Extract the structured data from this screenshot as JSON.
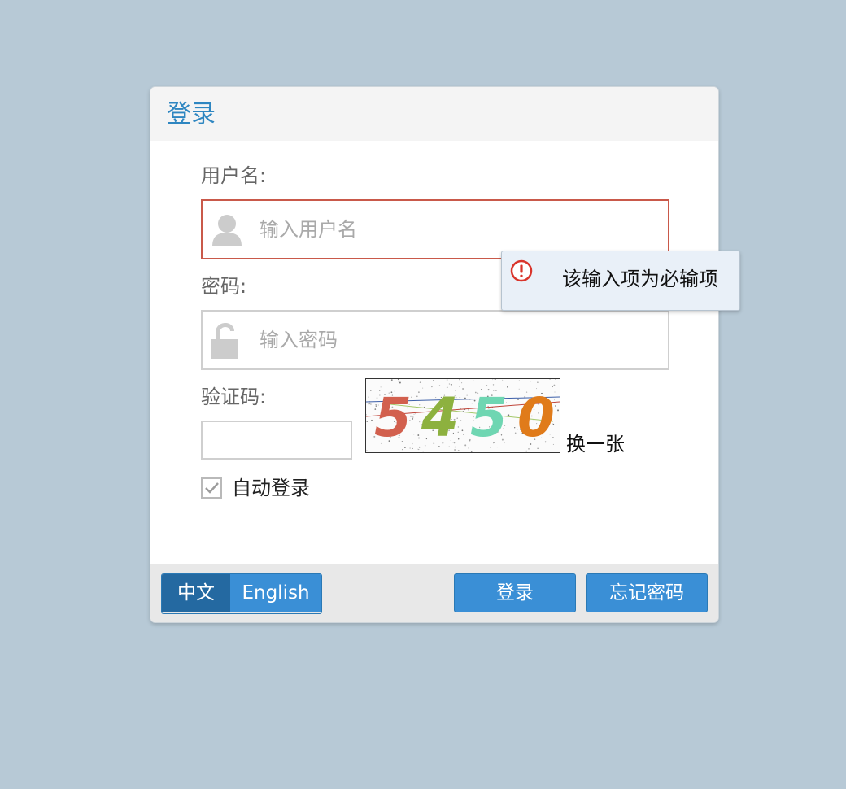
{
  "dialog": {
    "title": "登录"
  },
  "form": {
    "username_label": "用户名:",
    "username_placeholder": "输入用户名",
    "password_label": "密码:",
    "password_placeholder": "输入密码",
    "captcha_label": "验证码:",
    "captcha_value": "",
    "captcha_digits": [
      "5",
      "4",
      "5",
      "0"
    ],
    "captcha_colors": [
      "#d2604e",
      "#8db13f",
      "#6fd6b2",
      "#e07b1a"
    ],
    "refresh_label": "换一张",
    "remember_label": "自动登录",
    "remember_checked": true
  },
  "validation": {
    "message": "该输入项为必输项",
    "icon": "alert-circle-icon",
    "icon_color": "#d9342b"
  },
  "footer": {
    "lang_zh": "中文",
    "lang_en": "English",
    "login_button": "登录",
    "forgot_button": "忘记密码"
  },
  "colors": {
    "background": "#b7c9d6",
    "accent": "#3a8fd6",
    "accent_dark": "#2469a1",
    "title": "#2e86c1",
    "error_border": "#c9594a"
  }
}
